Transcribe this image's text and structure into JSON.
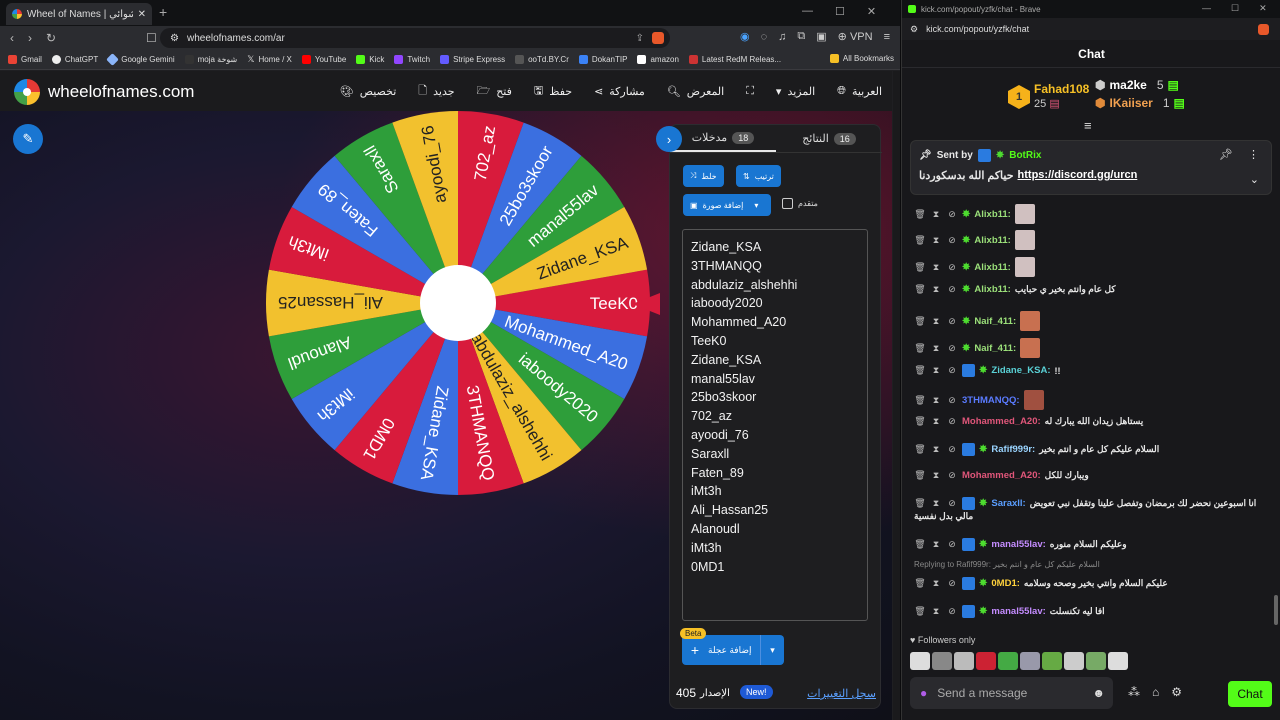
{
  "left_browser": {
    "tab_title": "Wheel of Names | سم العشوائي",
    "new_tab": "+",
    "url": "wheelofnames.com/ar",
    "vpn": "VPN",
    "bookmarks": [
      "Gmail",
      "ChatGPT",
      "Google Gemini",
      "moja شوخة",
      "Home / X",
      "YouTube",
      "Kick",
      "Twitch",
      "Stripe Express",
      "ooTd.BY.Cr",
      "DokanTIP",
      "amazon",
      "Latest RedM Releas..."
    ],
    "all_bookmarks": "All Bookmarks"
  },
  "site": {
    "logo_text": "wheelofnames.com",
    "menu": {
      "customize": "تخصيص",
      "new": "جديد",
      "open": "فتح",
      "save": "حفظ",
      "share": "مشاركة",
      "gallery": "المعرض",
      "more": "المزيد",
      "language": "العربية"
    }
  },
  "wheel": {
    "segments": [
      "TeeK0",
      "Mohammed_A20",
      "iaboody2020",
      "abdulaziz_alshehhi",
      "3THMANQQ",
      "Zidane_KSA",
      "0MD1",
      "iMt3h",
      "Alanoudl",
      "Ali_Hassan25",
      "iMt3h",
      "Faten_89",
      "Saraxll",
      "ayoodi_76",
      "702_az",
      "25bo3skoor",
      "manal55lav",
      "Zidane_KSA"
    ],
    "colors": [
      "#d81b3c",
      "#3b6fe0",
      "#2e9e3a",
      "#f2c12e",
      "#d81b3c",
      "#3b6fe0",
      "#d81b3c",
      "#3b6fe0",
      "#2e9e3a",
      "#f2c12e",
      "#d81b3c",
      "#3b6fe0",
      "#2e9e3a",
      "#f2c12e",
      "#d81b3c",
      "#3b6fe0",
      "#2e9e3a",
      "#f2c12e"
    ]
  },
  "panel": {
    "tab_entries": "مدخلات",
    "tab_entries_count": "18",
    "tab_results": "النتائج",
    "tab_results_count": "16",
    "shuffle": "خلط",
    "sort": "ترتيب",
    "add_image": "إضافة صورة",
    "advanced": "متقدم",
    "entries": [
      "Zidane_KSA",
      "3THMANQQ",
      "abdulaziz_alshehhi",
      "iaboody2020",
      "Mohammed_A20",
      "TeeK0",
      "Zidane_KSA",
      "manal55lav",
      "25bo3skoor",
      "702_az",
      "ayoodi_76",
      "Saraxll",
      "Faten_89",
      "iMt3h",
      "Ali_Hassan25",
      "Alanoudl",
      "iMt3h",
      "0MD1"
    ],
    "beta": "Beta",
    "add_wheel": "إضافة عجلة",
    "version_label": "الإصدار",
    "version": "405",
    "new_badge": "New!",
    "changelog": "سجل التغييرات"
  },
  "right_browser": {
    "title": "kick.com/popout/yzfk/chat - Brave",
    "url": "kick.com/popout/yzfk/chat"
  },
  "chat": {
    "header": "Chat",
    "leaders": [
      {
        "rank": "1",
        "name": "Fahad108",
        "count": "25"
      },
      {
        "name": "ma2ke",
        "count": "5"
      },
      {
        "name": "IKaiiser",
        "count": "1"
      }
    ],
    "pinned": {
      "sent_by": "Sent by",
      "sender": "BotRix",
      "link": "https://discord.gg/urcn",
      "text": "حياكم الله بدسكوردنا"
    },
    "messages": [
      {
        "user": "Alixb11:",
        "text": "",
        "color": "#9be07a",
        "emote": true
      },
      {
        "user": "Alixb11:",
        "text": "",
        "color": "#9be07a",
        "emote": true
      },
      {
        "user": "Alixb11:",
        "text": "",
        "color": "#9be07a",
        "emote": true
      },
      {
        "user": "Alixb11:",
        "text": "كل عام وانتم بخير ي حبايب",
        "color": "#9be07a",
        "emote": false
      },
      {
        "user": "Naif_411:",
        "text": "",
        "color": "#9be07a",
        "emote": true
      },
      {
        "user": "Naif_411:",
        "text": "",
        "color": "#9be07a",
        "emote": true
      },
      {
        "user": "Zidane_KSA:",
        "text": "!!",
        "color": "#5ad1d6",
        "emote": false
      },
      {
        "user": "3THMANQQ:",
        "text": "",
        "color": "#5a7bff",
        "emote": true
      },
      {
        "user": "Mohammed_A20:",
        "text": "يستاهل زيدان الله يبارك له",
        "color": "#e0567a",
        "emote": false
      },
      {
        "user": "Rafif999r:",
        "text": "السلام عليكم كل عام و انتم بخير",
        "color": "#9ad4ff",
        "emote": false
      },
      {
        "user": "Mohammed_A20:",
        "text": "ويبارك للكل",
        "color": "#e0567a",
        "emote": false
      },
      {
        "user": "Saraxll:",
        "text": "انا اسبوعين نحضر لك برمضان وتفصل علينا وتقفل نبي تعويض",
        "text2": "مالي بدل نفسية",
        "color": "#5a9eff",
        "emote": false
      },
      {
        "user": "manal55lav:",
        "text": "وعليكم السلام منوره",
        "color": "#c48cff",
        "emote": false
      },
      {
        "user": "0MD1:",
        "text": "عليكم السلام وانتي بخير وصحه وسلامه",
        "color": "#ffd23c",
        "emote": false,
        "reply": "Replying to Rafif999r: السلام عليكم كل عام و انتم بخير"
      },
      {
        "user": "manal55lav:",
        "text": "افا ليه تكنسلت",
        "color": "#c48cff",
        "emote": false
      }
    ],
    "followers_only": "Followers only",
    "input_placeholder": "Send a message",
    "send": "Chat"
  }
}
